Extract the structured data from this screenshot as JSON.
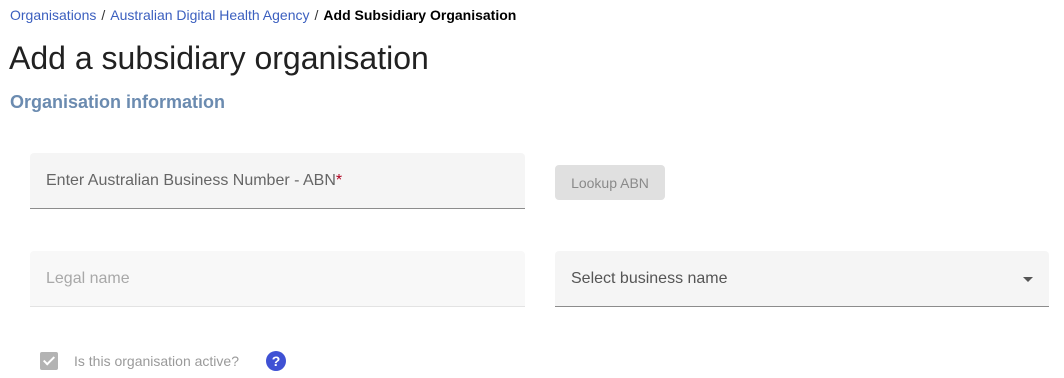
{
  "breadcrumb": {
    "items": [
      "Organisations",
      "Australian Digital Health Agency"
    ],
    "separator": "/",
    "current": "Add Subsidiary Organisation"
  },
  "page": {
    "title": "Add a subsidiary organisation",
    "section_title": "Organisation information"
  },
  "form": {
    "abn": {
      "label": "Enter Australian Business Number - ABN",
      "required_marker": "*",
      "value": ""
    },
    "lookup_button": {
      "label": "Lookup ABN",
      "disabled": true
    },
    "legal_name": {
      "label": "Legal name",
      "value": "",
      "disabled": true
    },
    "business_name": {
      "label": "Select business name",
      "icon": "chevron-down-icon"
    },
    "active": {
      "label": "Is this organisation active?",
      "checked": true,
      "disabled": true
    },
    "help_icon": {
      "glyph": "?",
      "color": "#3f51d4"
    }
  }
}
